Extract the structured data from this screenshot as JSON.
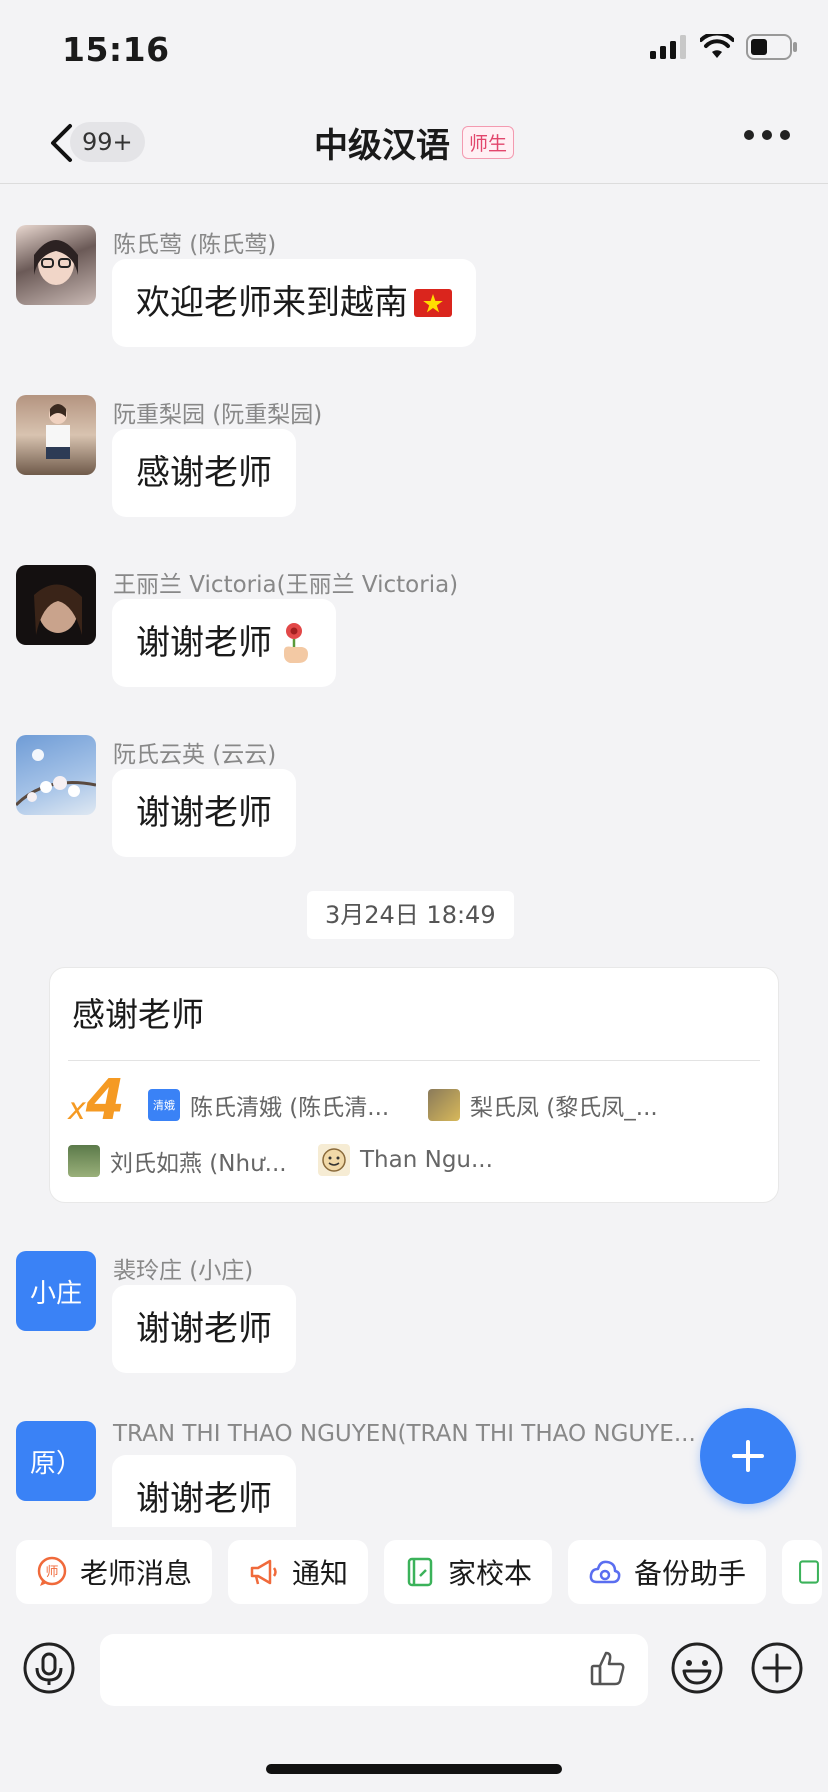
{
  "status_bar": {
    "time": "15:16"
  },
  "nav": {
    "unread_count": "99+",
    "title": "中级汉语",
    "title_tag": "师生"
  },
  "messages": [
    {
      "sender": "陈氏莺 (陈氏莺)",
      "text": "欢迎老师来到越南",
      "emoji": "🇻🇳"
    },
    {
      "sender": "阮重梨园 (阮重梨园)",
      "text": "感谢老师",
      "emoji": ""
    },
    {
      "sender": "王丽兰 Victoria(王丽兰 Victoria)",
      "text": "谢谢老师",
      "emoji": "🌹"
    },
    {
      "sender": "阮氏云英 (云云)",
      "text": "谢谢老师",
      "emoji": ""
    }
  ],
  "time_divider": "3月24日 18:49",
  "plus_one_card": {
    "text": "感谢老师",
    "multiplier_x": "x",
    "multiplier_n": "4",
    "voters": [
      {
        "name": "陈氏清娥 (陈氏清...",
        "icon_label": "清娥"
      },
      {
        "name": "梨氏凤 (黎氏凤_..."
      },
      {
        "name": "刘氏如燕 (Như..."
      },
      {
        "name": "Than Ngu..."
      }
    ]
  },
  "later_messages": [
    {
      "avatar_text": "小庄",
      "sender": "裴玲庄 (小庄)",
      "text": "谢谢老师"
    },
    {
      "avatar_text": "原）",
      "sender": "TRAN THI THAO NGUYEN(TRAN THI THAO NGUYE...",
      "text": "谢谢老师"
    }
  ],
  "quick_actions": [
    {
      "label": "老师消息",
      "icon": "teacher-message-icon"
    },
    {
      "label": "通知",
      "icon": "megaphone-icon"
    },
    {
      "label": "家校本",
      "icon": "notebook-icon"
    },
    {
      "label": "备份助手",
      "icon": "cloud-backup-icon"
    }
  ],
  "colors": {
    "accent_blue": "#3a82f6",
    "badge_pink": "#e2466c",
    "plus_one_orange": "#f59a23",
    "background": "#f3f3f5"
  }
}
